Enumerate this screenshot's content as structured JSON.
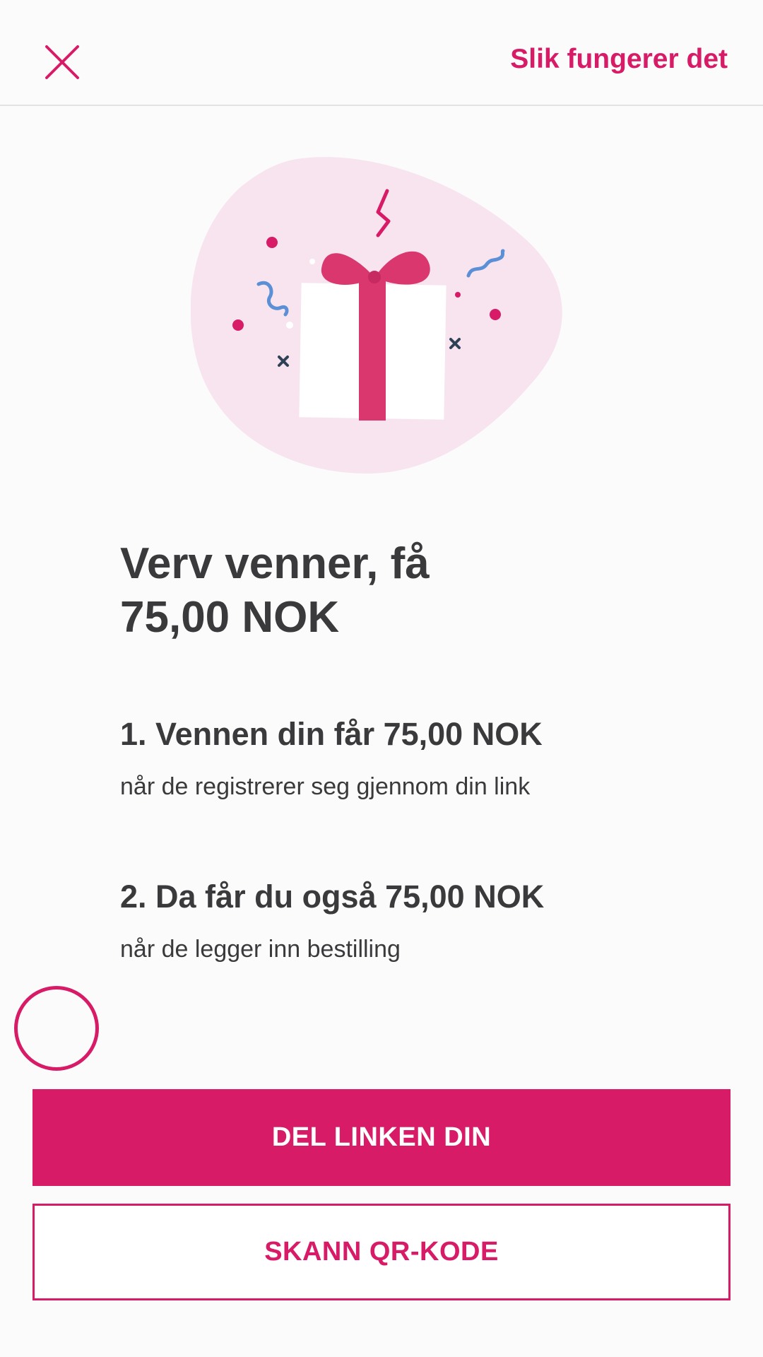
{
  "header": {
    "close_icon": "close-icon",
    "how_it_works_label": "Slik fungerer det"
  },
  "hero": {
    "illustration": "gift-icon"
  },
  "main": {
    "headline_line1": "Verv venner, få",
    "headline_line2": "75,00 NOK",
    "steps": [
      {
        "title": "1. Vennen din får 75,00 NOK",
        "description": "når de registrerer seg gjennom din link"
      },
      {
        "title": "2. Da får du også 75,00 NOK",
        "description": "når de legger inn bestilling"
      }
    ]
  },
  "actions": {
    "share_label": "DEL LINKEN DIN",
    "scan_label": "SKANN QR-KODE"
  },
  "colors": {
    "accent": "#d81b66",
    "text": "#3a3a3c",
    "blob": "#f7e4ee",
    "confetti_blue": "#5b8fd6",
    "confetti_dark": "#2f4156"
  }
}
